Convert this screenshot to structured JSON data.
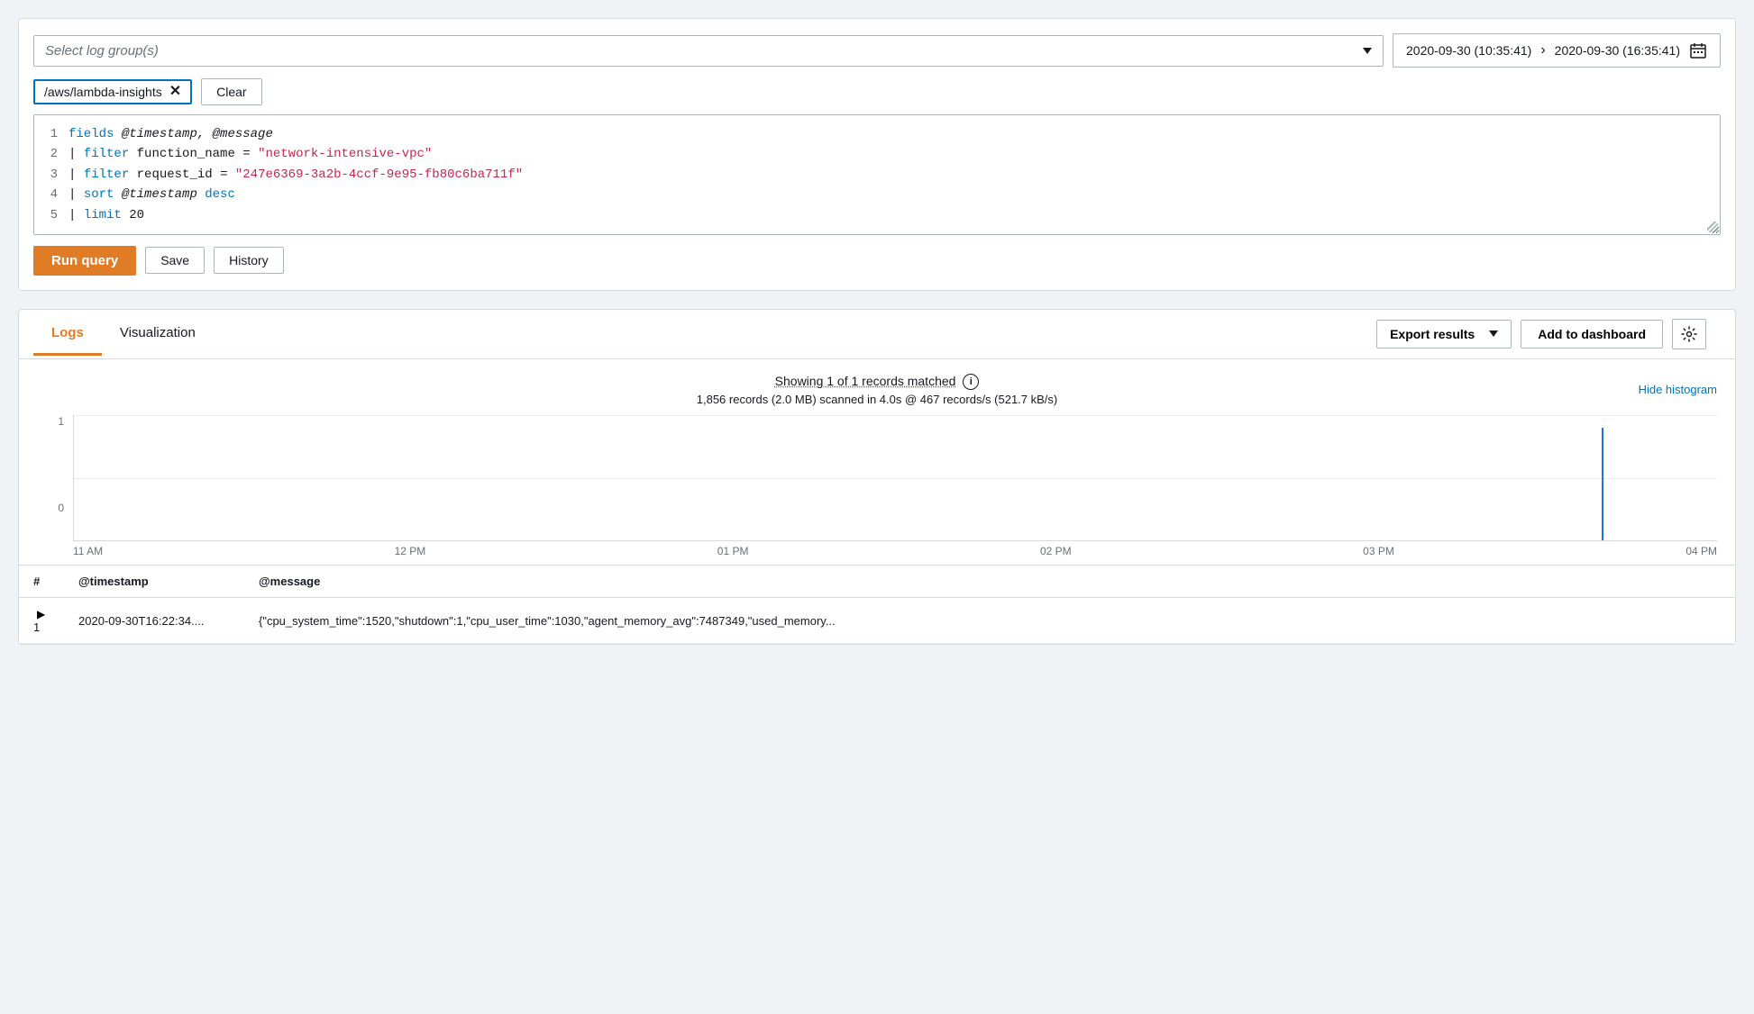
{
  "topPanel": {
    "logGroupSelect": {
      "placeholder": "Select log group(s)"
    },
    "dateRange": {
      "start": "2020-09-30 (10:35:41)",
      "end": "2020-09-30 (16:35:41)"
    },
    "selectedTag": "/aws/lambda-insights",
    "clearLabel": "Clear",
    "codeLines": [
      {
        "num": "1",
        "content": "fields @timestamp, @message"
      },
      {
        "num": "2",
        "content": "| filter function_name = \"network-intensive-vpc\""
      },
      {
        "num": "3",
        "content": "| filter request_id = \"247e6369-3a2b-4ccf-9e95-fb80c6ba711f\""
      },
      {
        "num": "4",
        "content": "| sort @timestamp desc"
      },
      {
        "num": "5",
        "content": "| limit 20"
      }
    ],
    "runQueryLabel": "Run query",
    "saveLabel": "Save",
    "historyLabel": "History"
  },
  "bottomPanel": {
    "tabs": [
      {
        "label": "Logs",
        "active": true
      },
      {
        "label": "Visualization",
        "active": false
      }
    ],
    "exportResultsLabel": "Export results",
    "addToDashboardLabel": "Add to dashboard",
    "histogramInfo": {
      "title": "Showing 1 of 1 records matched",
      "subtitle": "1,856 records (2.0 MB) scanned in 4.0s @ 467 records/s (521.7 kB/s)",
      "hideLabel": "Hide histogram"
    },
    "chart": {
      "yLabels": [
        "1",
        "0"
      ],
      "xLabels": [
        "11 AM",
        "12 PM",
        "01 PM",
        "02 PM",
        "03 PM",
        "04 PM"
      ],
      "spike": {
        "position": 0.93,
        "height": 0.9
      }
    },
    "tableHeaders": [
      "#",
      "@timestamp",
      "@message"
    ],
    "tableRows": [
      {
        "num": "1",
        "timestamp": "2020-09-30T16:22:34....",
        "message": "{\"cpu_system_time\":1520,\"shutdown\":1,\"cpu_user_time\":1030,\"agent_memory_avg\":7487349,\"used_memory..."
      }
    ]
  }
}
